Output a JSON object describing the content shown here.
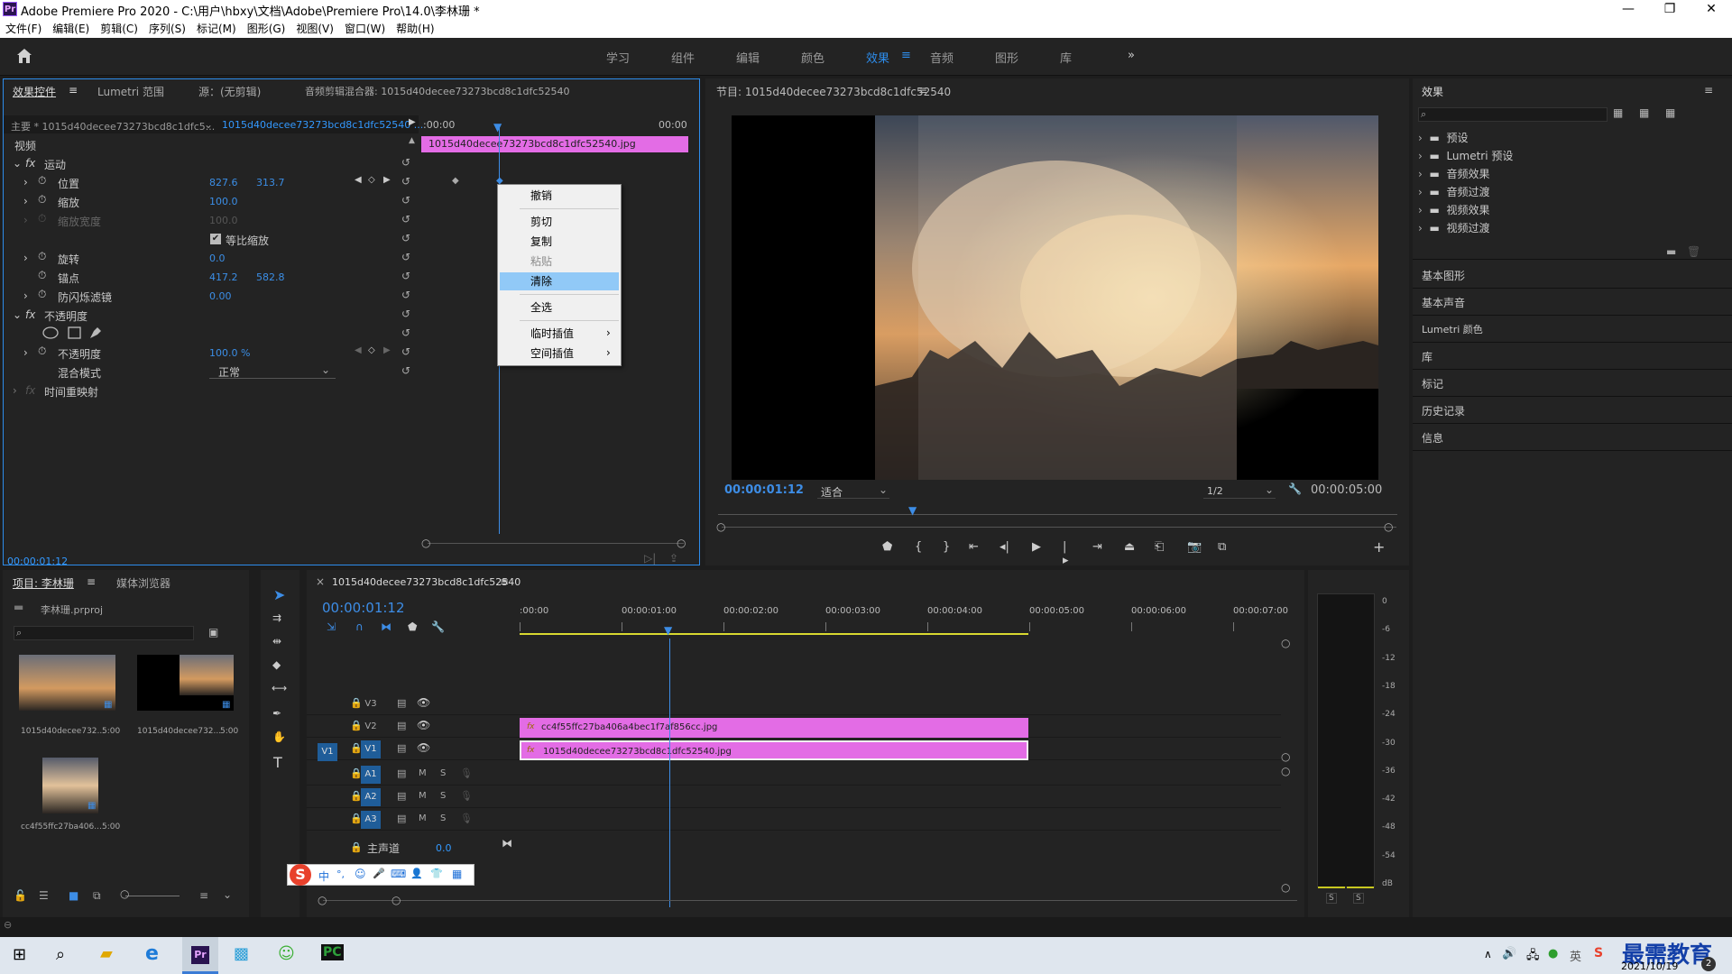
{
  "window": {
    "title": "Adobe Premiere Pro 2020 - C:\\用户\\hbxy\\文档\\Adobe\\Premiere Pro\\14.0\\李林珊 *",
    "logo": "Pr"
  },
  "menu": [
    "文件(F)",
    "编辑(E)",
    "剪辑(C)",
    "序列(S)",
    "标记(M)",
    "图形(G)",
    "视图(V)",
    "窗口(W)",
    "帮助(H)"
  ],
  "workspaces": [
    "学习",
    "组件",
    "编辑",
    "颜色",
    "效果",
    "音频",
    "图形",
    "库"
  ],
  "effect_controls": {
    "tabs": [
      "效果控件",
      "Lumetri 范围",
      "源：(无剪辑)",
      "音频剪辑混合器: 1015d40decee73273bcd8c1dfc52540"
    ],
    "master": "主要 * 1015d40decee73273bcd8c1dfc5...",
    "clip": "1015d40decee73273bcd8c1dfc52540 ...",
    "video": "视频",
    "motion": "运动",
    "position": "位置",
    "pos_x": "827.6",
    "pos_y": "313.7",
    "scale": "缩放",
    "scale_val": "100.0",
    "scale_width": "缩放宽度",
    "scale_width_val": "100.0",
    "uniform": "等比缩放",
    "rotation": "旋转",
    "rotation_val": "0.0",
    "anchor": "锚点",
    "anchor_x": "417.2",
    "anchor_y": "582.8",
    "flicker": "防闪烁滤镜",
    "flicker_val": "0.00",
    "opacity": "不透明度",
    "opacity_prop": "不透明度",
    "opacity_val": "100.0 %",
    "blend": "混合模式",
    "blend_val": "正常",
    "time_remap": "时间重映射",
    "tc_start": ":00:00",
    "tc_end": "00:00",
    "clip_bar": "1015d40decee73273bcd8c1dfc52540.jpg",
    "timecode": "00:00:01:12"
  },
  "context_menu": [
    "撤销",
    "剪切",
    "复制",
    "粘贴",
    "清除",
    "全选",
    "临时插值",
    "空间插值"
  ],
  "program": {
    "title": "节目: 1015d40decee73273bcd8c1dfc52540",
    "timecode": "00:00:01:12",
    "fit": "适合",
    "res": "1/2",
    "duration": "00:00:05:00"
  },
  "effects_panel": {
    "title": "效果",
    "items": [
      "预设",
      "Lumetri 预设",
      "音频效果",
      "音频过渡",
      "视频效果",
      "视频过渡"
    ],
    "sections": [
      "基本图形",
      "基本声音",
      "Lumetri 颜色",
      "库",
      "标记",
      "历史记录",
      "信息"
    ]
  },
  "project": {
    "tabs": [
      "项目: 李林珊",
      "媒体浏览器"
    ],
    "file": "李林珊.prproj",
    "items": [
      {
        "name": "1015d40decee732...",
        "dur": "5:00"
      },
      {
        "name": "1015d40decee732...",
        "dur": "5:00"
      },
      {
        "name": "cc4f55ffc27ba406...",
        "dur": "5:00"
      }
    ]
  },
  "timeline": {
    "title": "1015d40decee73273bcd8c1dfc52540",
    "timecode": "00:00:01:12",
    "ruler": [
      ":00:00",
      "00:00:01:00",
      "00:00:02:00",
      "00:00:03:00",
      "00:00:04:00",
      "00:00:05:00",
      "00:00:06:00",
      "00:00:07:00"
    ],
    "tracks": [
      "V3",
      "V2",
      "V1",
      "A1",
      "A2",
      "A3"
    ],
    "src_v1": "V1",
    "master": "主声道",
    "master_val": "0.0",
    "clip_v2": "cc4f55ffc27ba406a4bec1f7af856cc.jpg",
    "clip_v1": "1015d40decee73273bcd8c1dfc52540.jpg",
    "m": "M",
    "s": "S"
  },
  "meter": {
    "labels": [
      "0",
      "-6",
      "-12",
      "-18",
      "-24",
      "-30",
      "-36",
      "-42",
      "-48",
      "-54",
      "dB"
    ],
    "s": "S"
  },
  "ime": {
    "items": [
      "中",
      "°,",
      "☺",
      "🎤",
      "⌨",
      "👤",
      "👕",
      "▦"
    ]
  },
  "taskbar": {
    "date": "2021/10/19",
    "brand": "最需教育",
    "num": "2"
  },
  "colors": {
    "accent": "#2d8ceb",
    "clip": "#e36ce5",
    "playhead": "#3d8de6"
  }
}
